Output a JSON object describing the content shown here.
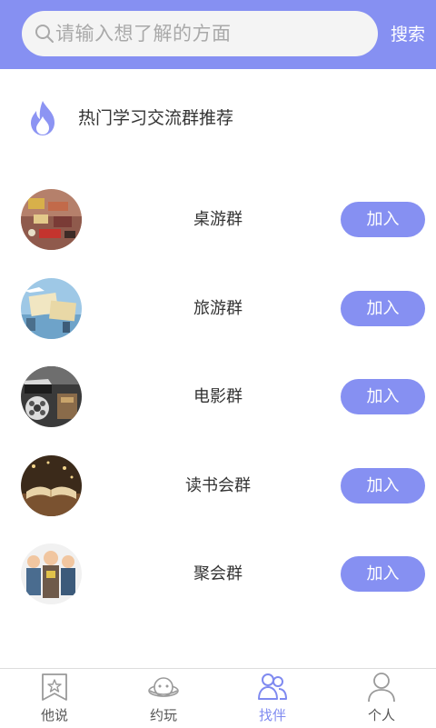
{
  "search": {
    "placeholder": "请输入想了解的方面",
    "button_label": "搜索"
  },
  "section": {
    "title": "热门学习交流群推荐"
  },
  "groups": [
    {
      "name": "桌游群",
      "join_label": "加入"
    },
    {
      "name": "旅游群",
      "join_label": "加入"
    },
    {
      "name": "电影群",
      "join_label": "加入"
    },
    {
      "name": "读书会群",
      "join_label": "加入"
    },
    {
      "name": "聚会群",
      "join_label": "加入"
    }
  ],
  "nav": {
    "items": [
      {
        "label": "他说",
        "icon": "bookmark-star-icon"
      },
      {
        "label": "约玩",
        "icon": "planet-icon"
      },
      {
        "label": "找伴",
        "icon": "friends-icon",
        "active": true
      },
      {
        "label": "个人",
        "icon": "person-icon"
      }
    ]
  },
  "colors": {
    "accent": "#8690f2",
    "active_nav": "#7f8af0",
    "flame": "#8c94f3"
  }
}
